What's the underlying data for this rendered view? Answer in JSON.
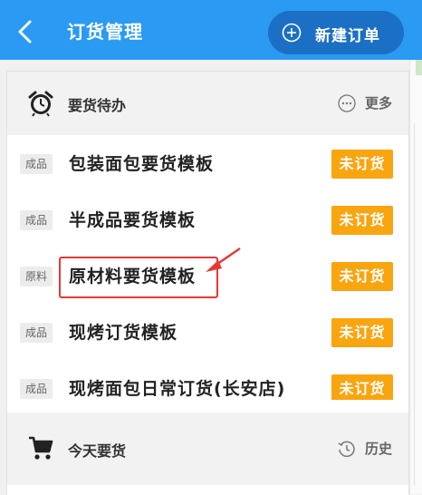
{
  "header": {
    "title": "订货管理",
    "new_order_label": "新建订单",
    "background": "#2a9af3"
  },
  "todo": {
    "title": "要货待办",
    "more_label": "更多"
  },
  "templates": [
    {
      "tag": "成品",
      "name": "包装面包要货模板",
      "status": "未订货"
    },
    {
      "tag": "成品",
      "name": "半成品要货模板",
      "status": "未订货"
    },
    {
      "tag": "原料",
      "name": "原材料要货模板",
      "status": "未订货"
    },
    {
      "tag": "成品",
      "name": "现烤订货模板",
      "status": "未订货"
    },
    {
      "tag": "成品",
      "name": "现烤面包日常订货(长安店)",
      "status": "未订货"
    }
  ],
  "today": {
    "title": "今天要货",
    "history_label": "历史"
  },
  "colors": {
    "status_badge": "#f9a510",
    "highlight": "#e53935"
  }
}
